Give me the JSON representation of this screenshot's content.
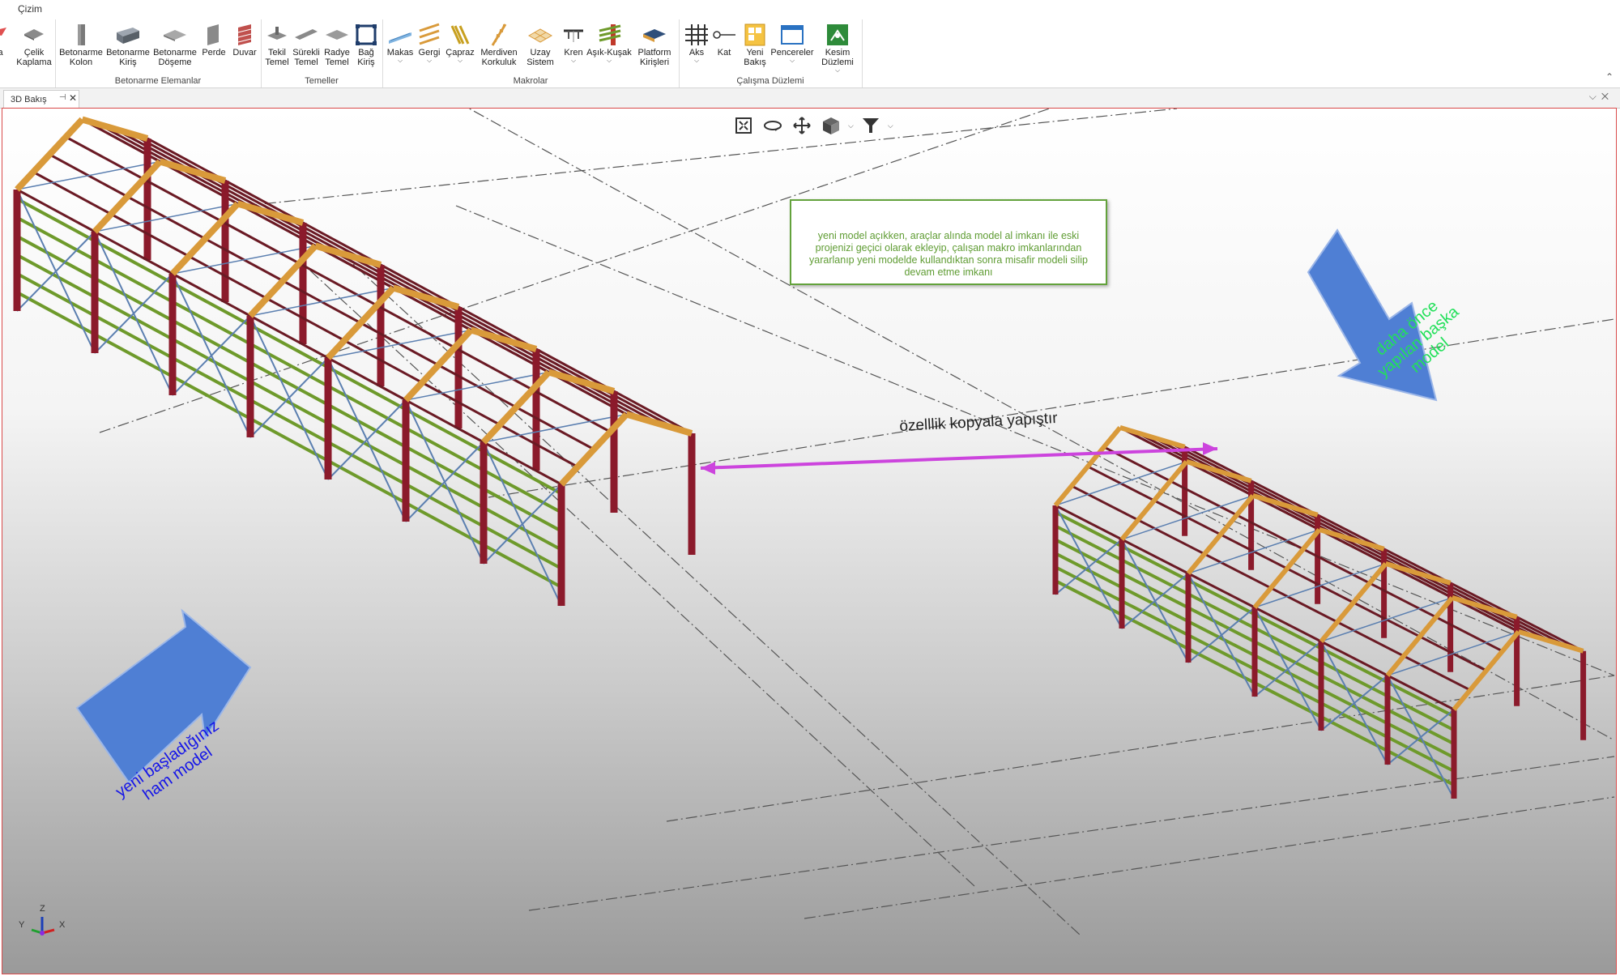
{
  "window": {
    "menu_tab": "Çizim"
  },
  "ribbon": {
    "groups": [
      {
        "label": "Betonarme Elemanlar"
      },
      {
        "label": "Temeller"
      },
      {
        "label": "Makrolar"
      },
      {
        "label": "Çalışma Düzlemi"
      }
    ],
    "buttons": {
      "b0": "ma",
      "b1": "Çelik\nKaplama",
      "b2": "Betonarme\nKolon",
      "b3": "Betonarme\nKiriş",
      "b4": "Betonarme\nDöşeme",
      "b5": "Perde",
      "b6": "Duvar",
      "b7": "Tekil\nTemel",
      "b8": "Sürekli\nTemel",
      "b9": "Radye\nTemel",
      "b10": "Bağ\nKiriş",
      "b11": "Makas",
      "b12": "Gergi",
      "b13": "Çapraz",
      "b14": "Merdiven\nKorkuluk",
      "b15": "Uzay\nSistem",
      "b16": "Kren",
      "b17": "Aşık-Kuşak",
      "b18": "Platform\nKirişleri",
      "b19": "Aks",
      "b20": "Kat",
      "b21": "Yeni\nBakış",
      "b22": "Pencereler",
      "b23": "Kesim\nDüzlemi"
    },
    "colors": {
      "steel_column": "#8b1a2b",
      "purlin": "#6e9a2b",
      "rafter": "#d99a3a",
      "bracing": "#5b7fb0",
      "note_border": "#63a23c"
    }
  },
  "document": {
    "tab_title": "3D Bakış"
  },
  "viewport": {
    "note": "yeni model açıkken, araçlar alında model al imkanı ile eski projenizi geçici olarak ekleyip, çalışan makro imkanlarından yararlanıp yeni modelde kullandıktan sonra misafir modeli silip devam etme imkanı",
    "copy_label": "özelllik kopyala yapıştır",
    "left_arrow_text": "yeni başladığınız ham model",
    "right_arrow_text": "daha önce yapılan başka model",
    "axis_x": "X",
    "axis_y": "Y",
    "axis_z": "Z"
  }
}
